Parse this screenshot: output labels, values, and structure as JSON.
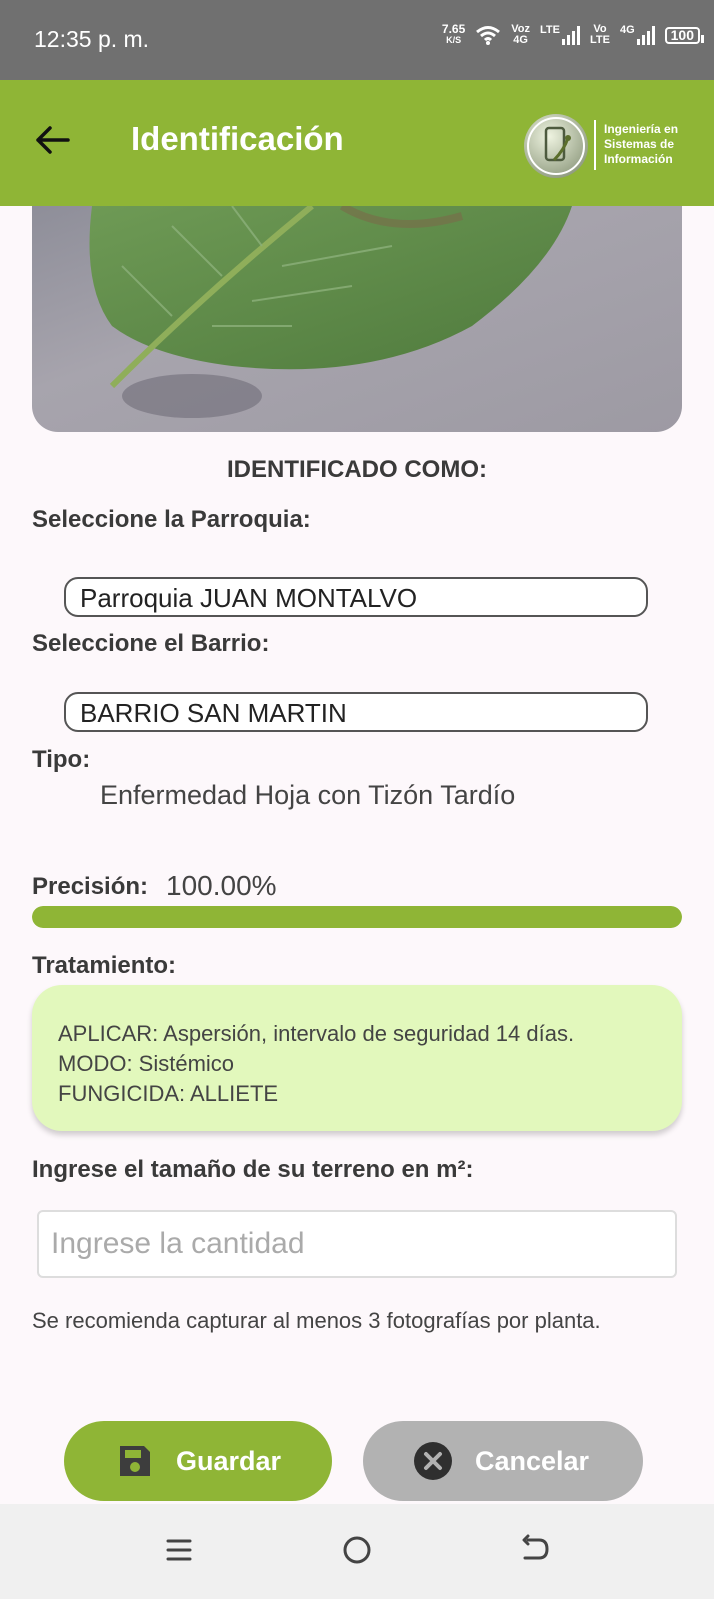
{
  "status_bar": {
    "time": "12:35 p. m.",
    "speed_value": "7.65",
    "speed_unit": "K/S",
    "voz_top": "Voz",
    "voz_bottom": "4G",
    "lte_label": "LTE",
    "vo_top": "Vo",
    "vo_bottom": "LTE",
    "net_label": "4G",
    "battery": "100",
    "icons": [
      "wifi-icon",
      "signal-icon",
      "battery-icon"
    ]
  },
  "app_bar": {
    "title": "Identificación",
    "back_icon": "arrow-left-icon",
    "logo_line1": "Ingeniería en",
    "logo_line2": "Sistemas de",
    "logo_line3": "Información"
  },
  "result": {
    "title": "IDENTIFICADO COMO:",
    "parroquia_label": "Seleccione la Parroquia:",
    "parroquia_value": "Parroquia JUAN MONTALVO",
    "barrio_label": "Seleccione el Barrio:",
    "barrio_value": "BARRIO SAN MARTIN",
    "tipo_label": "Tipo:",
    "tipo_value": "Enfermedad Hoja con Tizón Tardío",
    "precision_label": "Precisión:",
    "precision_value": "100.00%",
    "precision_fraction": 1.0,
    "tratamiento_label": "Tratamiento:",
    "tratamiento_lines": [
      "APLICAR: Aspersión, intervalo de seguridad 14 días.",
      "MODO: Sistémico",
      "FUNGICIDA: ALLIETE"
    ]
  },
  "terrain": {
    "label": "Ingrese el tamaño de su terreno en m²:",
    "placeholder": "Ingrese la cantidad",
    "value": "",
    "hint": "Se recomienda capturar al menos 3 fotografías por planta."
  },
  "actions": {
    "save_label": "Guardar",
    "save_icon": "save-icon",
    "cancel_label": "Cancelar",
    "cancel_icon": "close-circle-icon"
  },
  "colors": {
    "accent": "#8fb536",
    "status_bar": "#707070",
    "treatment_bg": "#e2f8bc",
    "cancel_bg": "#b2b2b2"
  },
  "nav_bar": {
    "icons": [
      "menu-icon",
      "home-icon",
      "back-icon"
    ]
  }
}
